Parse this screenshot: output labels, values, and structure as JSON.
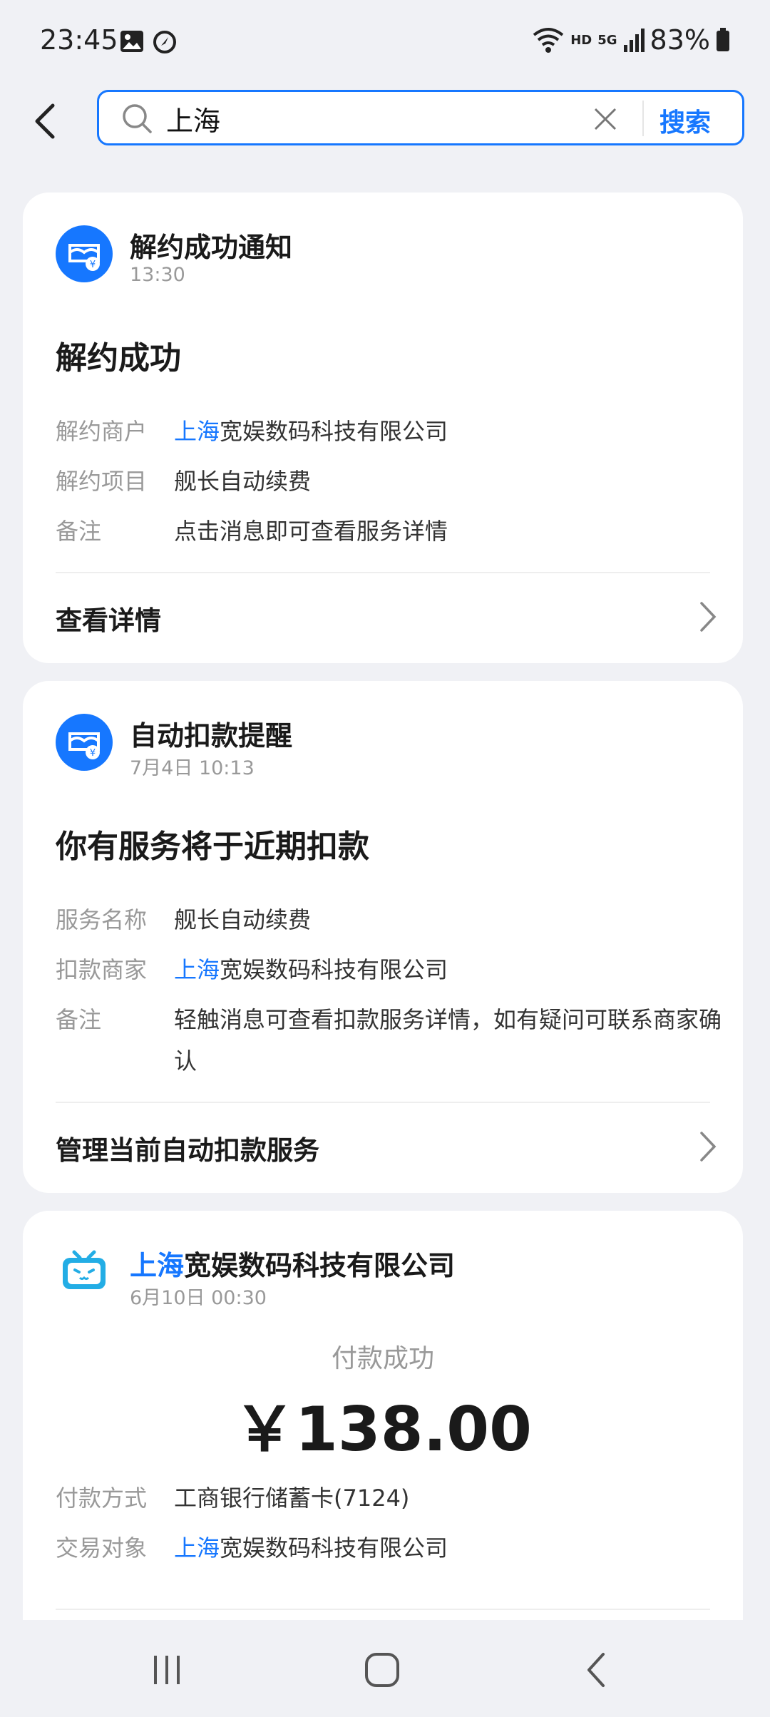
{
  "status_bar": {
    "time": "23:45",
    "battery": "83%",
    "hd": "HD",
    "net": "5G"
  },
  "search": {
    "query": "上海",
    "button_label": "搜索"
  },
  "cards": [
    {
      "title": "解约成功通知",
      "time": "13:30",
      "headline": "解约成功",
      "rows": [
        {
          "label": "解约商户",
          "value_highlight": "上海",
          "value_rest": "宽娱数码科技有限公司"
        },
        {
          "label": "解约项目",
          "value": "舰长自动续费"
        },
        {
          "label": "备注",
          "value": "点击消息即可查看服务详情"
        }
      ],
      "link": "查看详情"
    },
    {
      "title": "自动扣款提醒",
      "time": "7月4日 10:13",
      "headline": "你有服务将于近期扣款",
      "rows": [
        {
          "label": "服务名称",
          "value": "舰长自动续费"
        },
        {
          "label": "扣款商家",
          "value_highlight": "上海",
          "value_rest": "宽娱数码科技有限公司"
        },
        {
          "label": "备注",
          "value": "轻触消息可查看扣款服务详情，如有疑问可联系商家确认"
        }
      ],
      "link": "管理当前自动扣款服务"
    },
    {
      "title_highlight": "上海",
      "title_rest": "宽娱数码科技有限公司",
      "time": "6月10日 00:30",
      "pay_status": "付款成功",
      "amount": "￥138.00",
      "rows": [
        {
          "label": "付款方式",
          "value": "工商银行储蓄卡(7124)"
        },
        {
          "label": "交易对象",
          "value_highlight": "上海",
          "value_rest": "宽娱数码科技有限公司"
        }
      ]
    }
  ],
  "colors": {
    "accent": "#1677ff",
    "background": "#f0f1f5"
  }
}
